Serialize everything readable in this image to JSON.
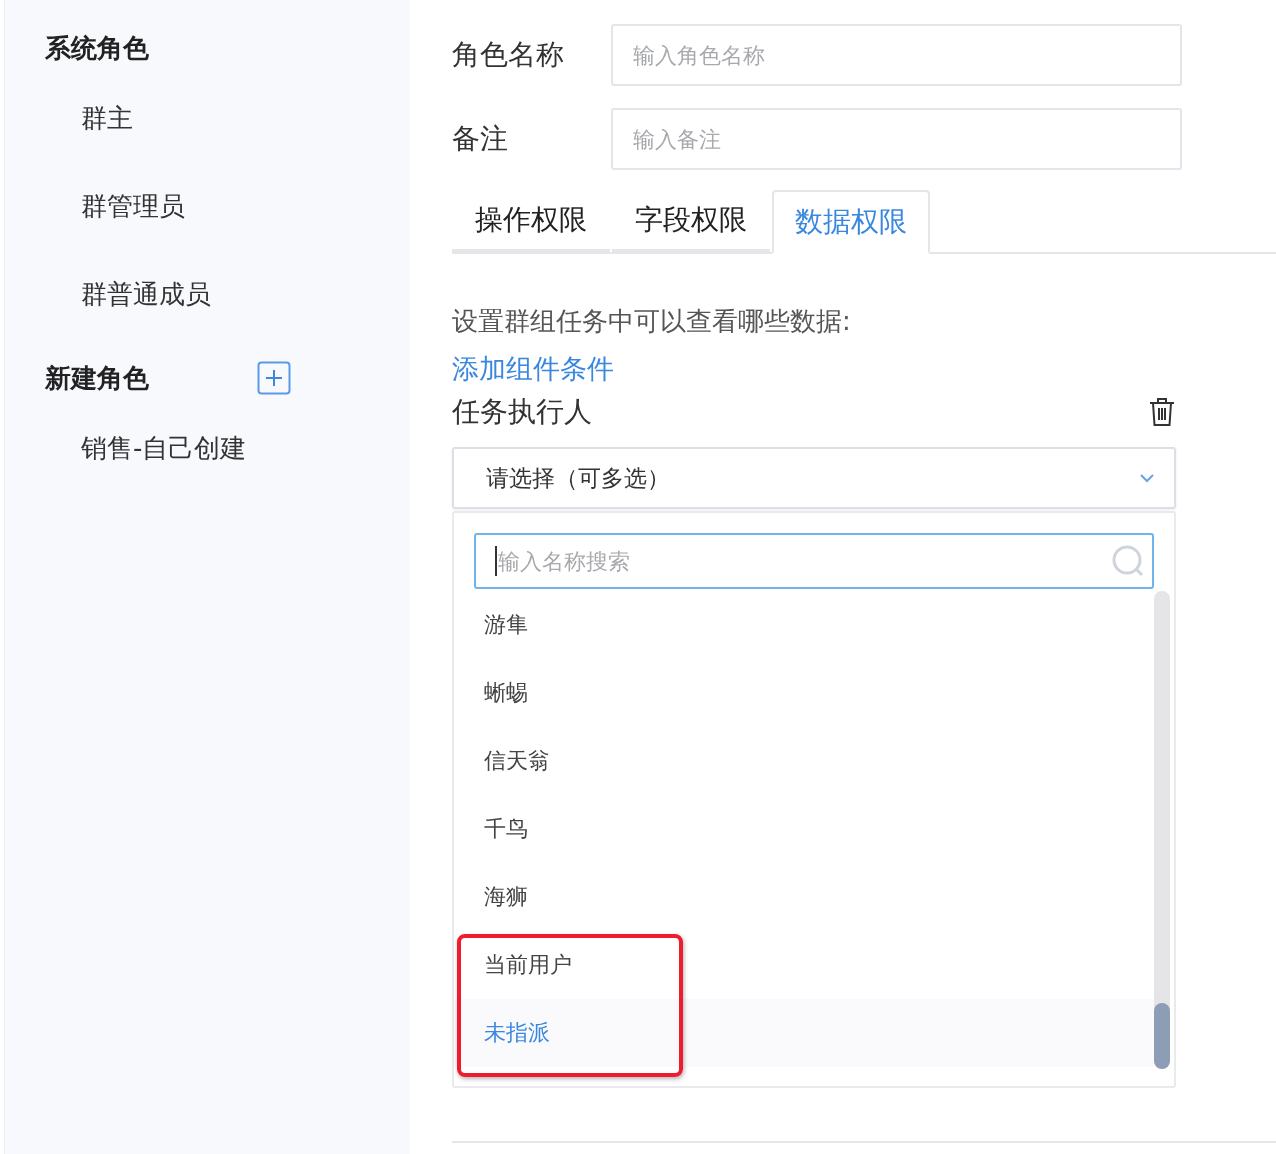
{
  "sidebar": {
    "groups": [
      {
        "title": "系统角色",
        "add_button": false,
        "items": [
          {
            "label": "群主",
            "selected": false
          },
          {
            "label": "群管理员",
            "selected": false
          },
          {
            "label": "群普通成员",
            "selected": false
          }
        ]
      },
      {
        "title": "新建角色",
        "add_button": true,
        "items": [
          {
            "label": "销售-自己创建",
            "selected": false
          }
        ]
      }
    ]
  },
  "form": {
    "fields": [
      {
        "label": "角色名称",
        "placeholder": "输入角色名称"
      },
      {
        "label": "备注",
        "placeholder": "输入备注"
      }
    ]
  },
  "tabs": [
    {
      "label": "操作权限",
      "selected": false
    },
    {
      "label": "字段权限",
      "selected": false
    },
    {
      "label": "数据权限",
      "selected": true
    }
  ],
  "description": "设置群组任务中可以查看哪些数据:",
  "add_link": "添加组件条件",
  "condition": {
    "label": "任务执行人",
    "select": {
      "value": "请选择（可多选）",
      "expanded": true
    },
    "search": {
      "placeholder": "输入名称搜索"
    },
    "options": [
      {
        "label": "游隼",
        "selected": false
      },
      {
        "label": "蜥蜴",
        "selected": false
      },
      {
        "label": "信天翁",
        "selected": false
      },
      {
        "label": "千鸟",
        "selected": false
      },
      {
        "label": "海狮",
        "selected": false
      },
      {
        "label": "当前用户",
        "selected": false
      },
      {
        "label": "未指派",
        "selected": true
      }
    ]
  }
}
